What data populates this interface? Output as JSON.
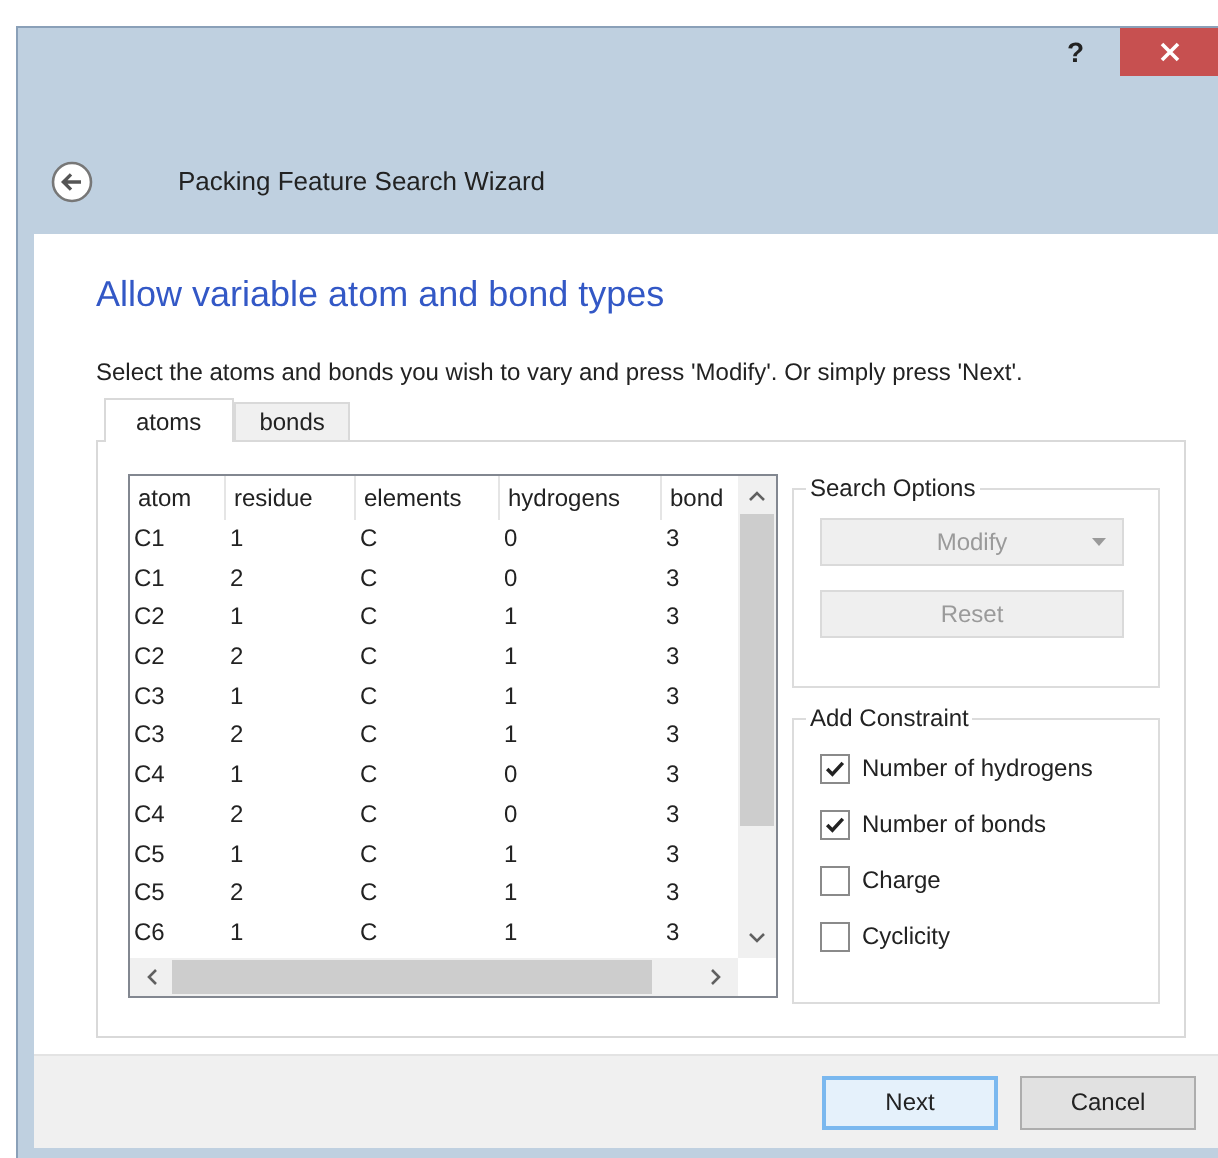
{
  "window": {
    "title": "Packing Feature Search Wizard",
    "help": "?"
  },
  "heading": "Allow variable atom and bond types",
  "instruction": "Select the atoms and bonds you wish to vary and press 'Modify'. Or simply press 'Next'.",
  "tabs": [
    {
      "label": "atoms",
      "selected": true
    },
    {
      "label": "bonds",
      "selected": false
    }
  ],
  "table": {
    "columns": [
      "atom",
      "residue",
      "elements",
      "hydrogens",
      "bond"
    ],
    "rows": [
      [
        "C1",
        "1",
        "C",
        "0",
        "3"
      ],
      [
        "C1",
        "2",
        "C",
        "0",
        "3"
      ],
      [
        "C2",
        "1",
        "C",
        "1",
        "3"
      ],
      [
        "C2",
        "2",
        "C",
        "1",
        "3"
      ],
      [
        "C3",
        "1",
        "C",
        "1",
        "3"
      ],
      [
        "C3",
        "2",
        "C",
        "1",
        "3"
      ],
      [
        "C4",
        "1",
        "C",
        "0",
        "3"
      ],
      [
        "C4",
        "2",
        "C",
        "0",
        "3"
      ],
      [
        "C5",
        "1",
        "C",
        "1",
        "3"
      ],
      [
        "C5",
        "2",
        "C",
        "1",
        "3"
      ],
      [
        "C6",
        "1",
        "C",
        "1",
        "3"
      ]
    ]
  },
  "search_options": {
    "title": "Search Options",
    "buttons": [
      {
        "label": "Modify",
        "kind": "dropdown",
        "disabled": true
      },
      {
        "label": "Reset",
        "kind": "plain",
        "disabled": true
      }
    ]
  },
  "add_constraint": {
    "title": "Add Constraint",
    "options": [
      {
        "label": "Number of hydrogens",
        "checked": true
      },
      {
        "label": "Number of bonds",
        "checked": true
      },
      {
        "label": "Charge",
        "checked": false
      },
      {
        "label": "Cyclicity",
        "checked": false
      }
    ]
  },
  "footer_buttons": [
    {
      "label": "Next",
      "default": true
    },
    {
      "label": "Cancel",
      "default": false
    }
  ]
}
